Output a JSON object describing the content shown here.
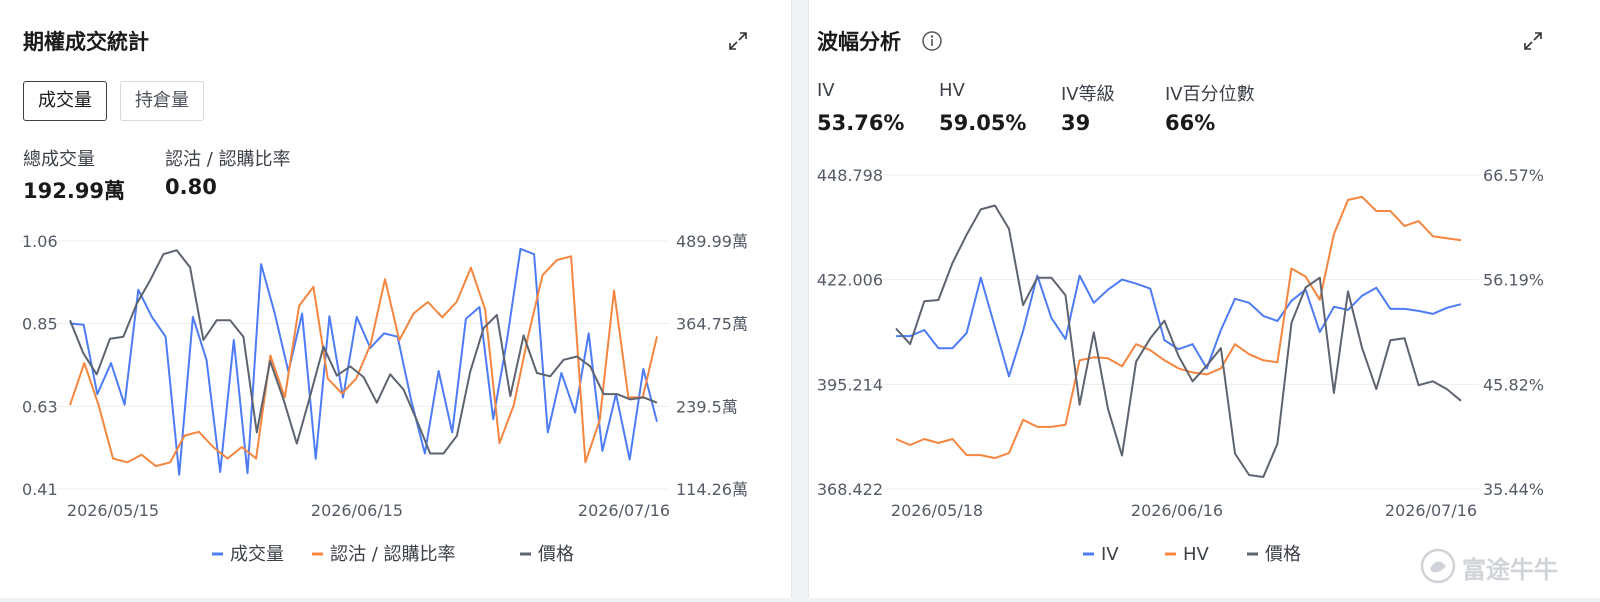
{
  "left": {
    "title": "期權成交統計",
    "tabs": [
      {
        "label": "成交量",
        "active": true
      },
      {
        "label": "持倉量",
        "active": false
      }
    ],
    "stats": [
      {
        "label": "總成交量",
        "value": "192.99萬"
      },
      {
        "label": "認沽 / 認購比率",
        "value": "0.80"
      }
    ]
  },
  "right": {
    "title": "波幅分析",
    "stats": [
      {
        "label": "IV",
        "value": "53.76%"
      },
      {
        "label": "HV",
        "value": "59.05%"
      },
      {
        "label": "IV等級",
        "value": "39"
      },
      {
        "label": "IV百分位數",
        "value": "66%"
      }
    ]
  },
  "watermark": "富途牛牛",
  "chart_data": [
    {
      "type": "line",
      "x_ticks": [
        "2026/05/15",
        "2026/06/15",
        "2026/07/16"
      ],
      "left_axis": {
        "ticks": [
          "1.06",
          "0.85",
          "0.63",
          "0.41"
        ],
        "ylim": [
          0.41,
          1.06
        ]
      },
      "right_axis": {
        "ticks": [
          "489.99萬",
          "364.75萬",
          "239.5萬",
          "114.26萬"
        ],
        "ylim": [
          114.26,
          489.99
        ]
      },
      "legend_position": "bottom",
      "series": [
        {
          "name": "成交量",
          "axis": "right",
          "color": "#4e7cf6",
          "values": [
            365,
            363,
            258,
            305,
            242,
            416,
            375,
            345,
            136,
            375,
            310,
            140,
            340,
            138,
            455,
            380,
            292,
            380,
            160,
            376,
            253,
            375,
            328,
            350,
            345,
            248,
            168,
            293,
            200,
            372,
            390,
            220,
            338,
            478,
            470,
            200,
            290,
            230,
            350,
            172,
            258,
            159,
            296,
            216
          ]
        },
        {
          "name": "認沽 / 認購比率",
          "axis": "left",
          "color": "#f5853f",
          "values": [
            0.63,
            0.74,
            0.63,
            0.49,
            0.48,
            0.5,
            0.47,
            0.48,
            0.55,
            0.56,
            0.52,
            0.49,
            0.52,
            0.49,
            0.76,
            0.65,
            0.89,
            0.94,
            0.7,
            0.66,
            0.7,
            0.79,
            0.96,
            0.8,
            0.87,
            0.9,
            0.86,
            0.9,
            0.99,
            0.88,
            0.53,
            0.63,
            0.81,
            0.97,
            1.01,
            1.02,
            0.48,
            0.59,
            0.93,
            0.65,
            0.65,
            0.81
          ]
        },
        {
          "name": "價格",
          "axis": "right",
          "color": "#5d6470",
          "values": [
            370,
            320,
            288,
            342,
            345,
            395,
            430,
            470,
            476,
            450,
            340,
            370,
            370,
            345,
            200,
            308,
            250,
            183,
            255,
            330,
            286,
            300,
            284,
            245,
            288,
            265,
            218,
            168,
            168,
            195,
            292,
            358,
            378,
            255,
            347,
            290,
            285,
            310,
            315,
            300,
            258,
            258,
            250,
            253,
            245
          ]
        }
      ]
    },
    {
      "type": "line",
      "x_ticks": [
        "2026/05/18",
        "2026/06/16",
        "2026/07/16"
      ],
      "left_axis": {
        "ticks": [
          "448.798",
          "422.006",
          "395.214",
          "368.422"
        ],
        "ylim": [
          368.422,
          448.798
        ]
      },
      "right_axis": {
        "ticks": [
          "66.57%",
          "56.19%",
          "45.82%",
          "35.44%"
        ],
        "ylim": [
          35.44,
          66.57
        ]
      },
      "legend_position": "bottom",
      "series": [
        {
          "name": "IV",
          "axis": "right",
          "color": "#4e7cf6",
          "values": [
            50.6,
            50.6,
            51.2,
            49.4,
            49.4,
            50.9,
            56.4,
            51.5,
            46.6,
            51.1,
            56.6,
            52.4,
            50.3,
            56.6,
            53.9,
            55.2,
            56.2,
            55.8,
            55.3,
            50.2,
            49.3,
            49.8,
            47.4,
            51.2,
            54.3,
            53.9,
            52.6,
            52.1,
            54.1,
            55.2,
            51.0,
            53.5,
            53.2,
            54.6,
            55.4,
            53.3,
            53.3,
            53.1,
            52.8,
            53.4,
            53.76
          ]
        },
        {
          "name": "HV",
          "axis": "right",
          "color": "#f5853f",
          "values": [
            40.4,
            39.8,
            40.4,
            40.0,
            40.4,
            38.8,
            38.8,
            38.5,
            39.0,
            42.3,
            41.6,
            41.6,
            41.8,
            48.2,
            48.5,
            48.4,
            47.6,
            49.8,
            49.2,
            48.2,
            47.4,
            47.0,
            46.8,
            47.4,
            49.8,
            48.8,
            48.2,
            48.0,
            57.3,
            56.5,
            54.2,
            60.7,
            64.1,
            64.4,
            63.0,
            63.0,
            61.5,
            62.0,
            60.5,
            60.3,
            60.1
          ]
        },
        {
          "name": "價格",
          "axis": "left",
          "color": "#5d6470",
          "values": [
            409.5,
            405.5,
            416.5,
            416.8,
            426.3,
            433.5,
            440.0,
            441.0,
            435.0,
            415.5,
            422.5,
            422.5,
            418.0,
            390.0,
            408.5,
            389.0,
            377.0,
            401.0,
            407.0,
            411.5,
            402.5,
            396.0,
            400.0,
            404.5,
            377.5,
            372.0,
            371.5,
            380.0,
            411.0,
            420.0,
            422.5,
            393.0,
            419.0,
            404.5,
            394.0,
            406.5,
            407.0,
            395.0,
            396.0,
            394.0,
            391.0
          ]
        }
      ]
    }
  ]
}
